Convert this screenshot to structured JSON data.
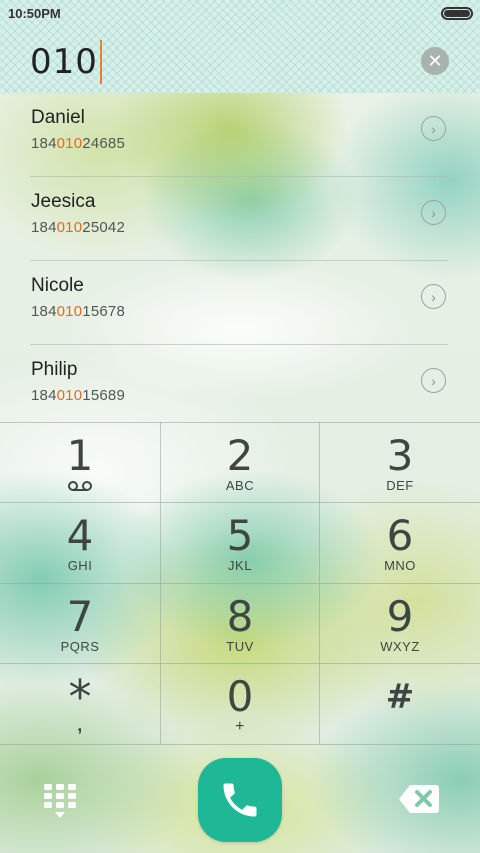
{
  "status_bar": {
    "time": "10:50PM"
  },
  "dialer": {
    "input_value": "010"
  },
  "contacts": [
    {
      "name": "Daniel",
      "number_prefix": "184",
      "number_match": "010",
      "number_suffix": "24685"
    },
    {
      "name": "Jeesica",
      "number_prefix": "184",
      "number_match": "010",
      "number_suffix": "25042"
    },
    {
      "name": "Nicole",
      "number_prefix": "184",
      "number_match": "010",
      "number_suffix": "15678"
    },
    {
      "name": "Philip",
      "number_prefix": "184",
      "number_match": "010",
      "number_suffix": "15689"
    }
  ],
  "keypad": [
    {
      "digit": "1",
      "letters": ""
    },
    {
      "digit": "2",
      "letters": "ABC"
    },
    {
      "digit": "3",
      "letters": "DEF"
    },
    {
      "digit": "4",
      "letters": "GHI"
    },
    {
      "digit": "5",
      "letters": "JKL"
    },
    {
      "digit": "6",
      "letters": "MNO"
    },
    {
      "digit": "7",
      "letters": "PQRS"
    },
    {
      "digit": "8",
      "letters": "TUV"
    },
    {
      "digit": "9",
      "letters": "WXYZ"
    },
    {
      "digit": "*",
      "letters": ","
    },
    {
      "digit": "0",
      "letters": "+"
    },
    {
      "digit": "#",
      "letters": ""
    }
  ],
  "colors": {
    "accent_call": "#1eb896",
    "match_highlight": "#e36a1e",
    "caret": "#e8802a"
  },
  "icons": {
    "voicemail": "voicemail-icon",
    "dialpad": "dialpad-icon",
    "backspace": "backspace-icon",
    "phone": "phone-icon",
    "clear": "clear-icon",
    "chevron": "chevron-right-icon"
  }
}
